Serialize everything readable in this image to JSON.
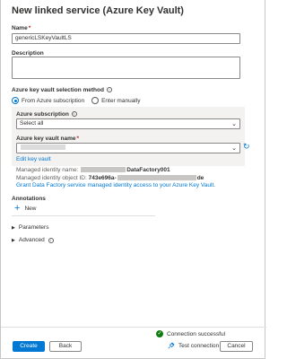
{
  "header": {
    "title": "New linked service (Azure Key Vault)"
  },
  "fields": {
    "name_label": "Name",
    "required_mark": "*",
    "name_value": "genericLSKeyVaultLS",
    "description_label": "Description",
    "description_value": ""
  },
  "selection_method": {
    "label": "Azure key vault selection method",
    "options": [
      "From Azure subscription",
      "Enter manually"
    ],
    "selected": "From Azure subscription"
  },
  "subscription": {
    "label": "Azure subscription",
    "value": "Select all"
  },
  "vault_name": {
    "label": "Azure key vault name",
    "value": ""
  },
  "links": {
    "edit_key_vault": "Edit key vault",
    "grant_access": "Grant Data Factory service managed identity access to your Azure Key Vault."
  },
  "identity": {
    "name_label": "Managed identity name:",
    "name_value_suffix": "DataFactory001",
    "object_id_label": "Managed identity object ID:",
    "object_id_prefix": "743e696a-",
    "object_id_suffix": "de"
  },
  "annotations": {
    "label": "Annotations",
    "new_label": "New",
    "plus_symbol": "+"
  },
  "sections": {
    "parameters": "Parameters",
    "advanced": "Advanced"
  },
  "footer": {
    "status_text": "Connection successful",
    "create_label": "Create",
    "back_label": "Back",
    "test_label": "Test connection",
    "cancel_label": "Cancel"
  },
  "icons": {
    "info": "info-icon",
    "chevron": "chevron-down-icon",
    "refresh": "refresh-icon",
    "check": "checkmark-circle-icon",
    "plug": "plug-icon",
    "triangle": "triangle-right-icon"
  },
  "colors": {
    "accent": "#0078d4",
    "success": "#107c10",
    "required": "#a4262c"
  }
}
